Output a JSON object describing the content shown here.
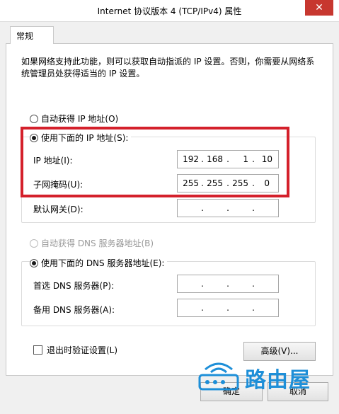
{
  "window": {
    "title": "Internet 协议版本 4 (TCP/IPv4) 属性",
    "close_glyph": "✕"
  },
  "tabs": [
    {
      "label": "常规"
    }
  ],
  "description": "如果网络支持此功能，则可以获取自动指派的 IP 设置。否则，你需要从网络系统管理员处获得适当的 IP 设置。",
  "ip": {
    "auto_label": "自动获得 IP 地址(O)",
    "manual_label": "使用下面的 IP 地址(S):",
    "selected": "manual",
    "address_label": "IP 地址(I):",
    "address": [
      "192",
      "168",
      "1",
      "10"
    ],
    "mask_label": "子网掩码(U):",
    "mask": [
      "255",
      "255",
      "255",
      "0"
    ],
    "gateway_label": "默认网关(D):",
    "gateway": [
      "",
      "",
      "",
      ""
    ]
  },
  "dns": {
    "auto_label": "自动获得 DNS 服务器地址(B)",
    "manual_label": "使用下面的 DNS 服务器地址(E):",
    "selected": "manual",
    "preferred_label": "首选 DNS 服务器(P):",
    "preferred": [
      "",
      "",
      "",
      ""
    ],
    "alternate_label": "备用 DNS 服务器(A):",
    "alternate": [
      "",
      "",
      "",
      ""
    ]
  },
  "validate_label": "退出时验证设置(L)",
  "validate_checked": false,
  "buttons": {
    "advanced": "高级(V)...",
    "ok": "确定",
    "cancel": "取消"
  },
  "watermark": {
    "text": "路由屋",
    "icon": "router-icon"
  },
  "colors": {
    "highlight_box": "#d4202b",
    "watermark": "#1e8fd8"
  }
}
